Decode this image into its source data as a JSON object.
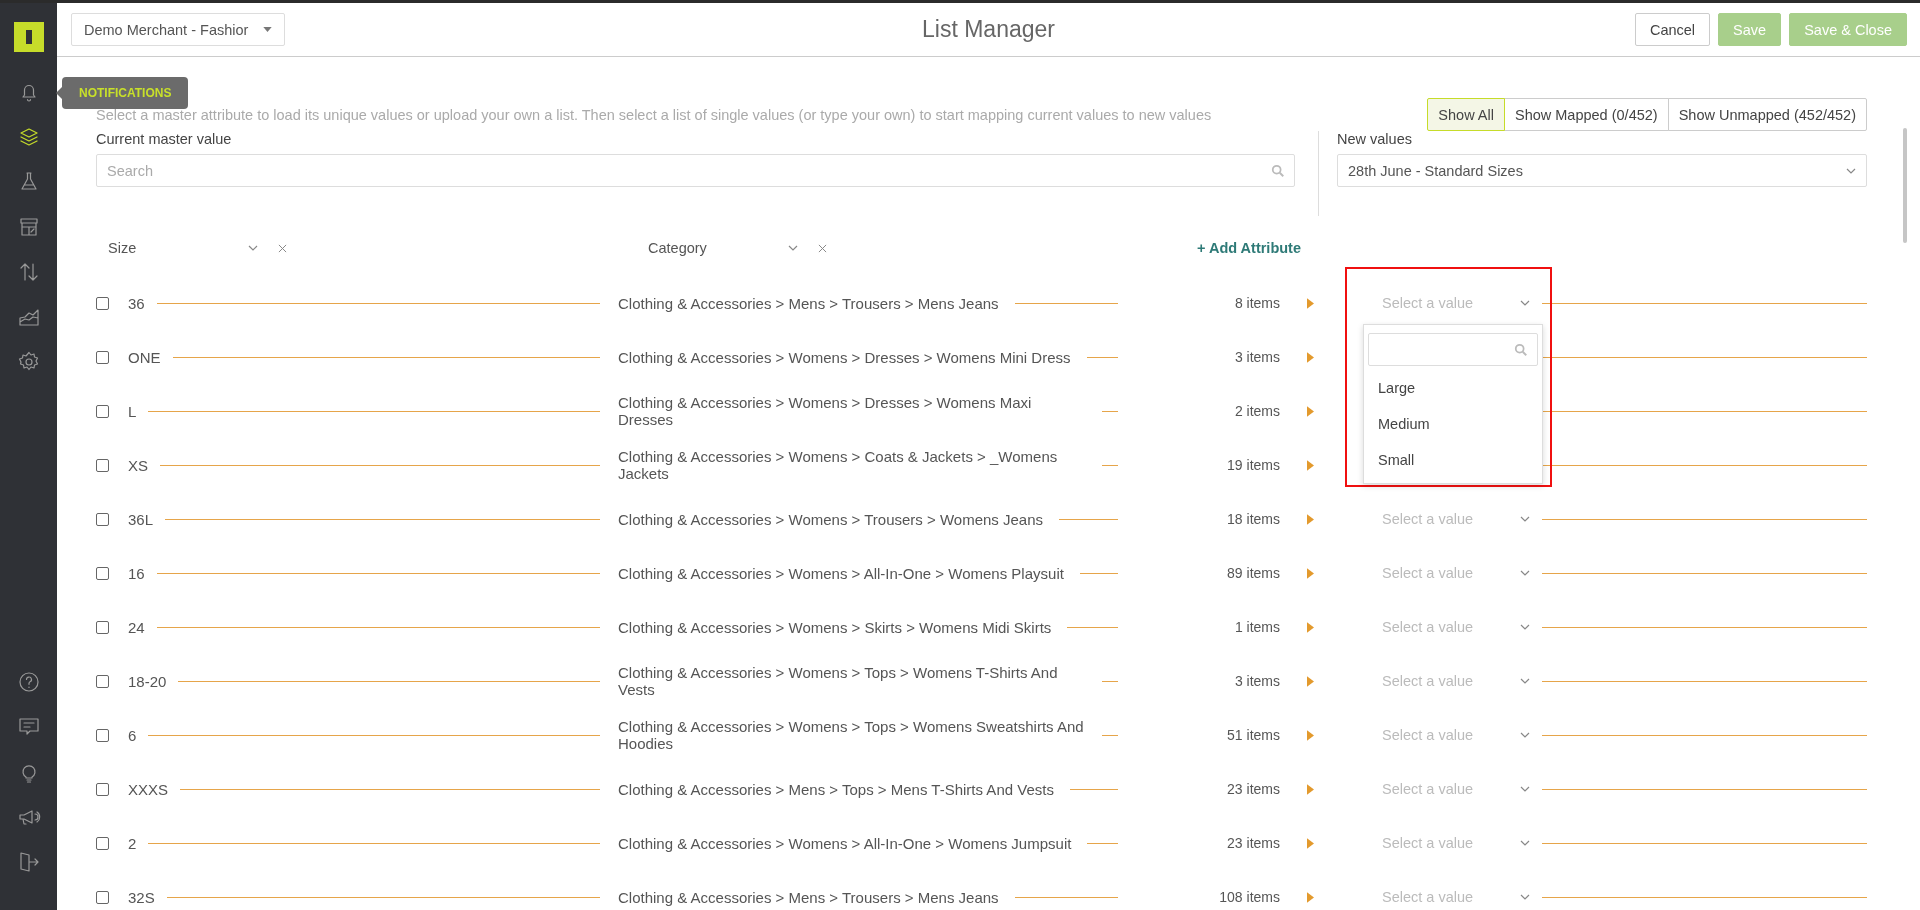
{
  "sidebar": {
    "items": [
      {
        "selected": false
      },
      {
        "selected": true
      },
      {
        "selected": false
      },
      {
        "selected": false
      },
      {
        "selected": false
      },
      {
        "selected": false
      },
      {
        "selected": false
      }
    ],
    "bottom_items": [
      {
        "selected": false
      },
      {
        "selected": false
      },
      {
        "selected": false
      },
      {
        "selected": false
      },
      {
        "selected": false
      }
    ]
  },
  "tooltip": {
    "text": "NOTIFICATIONS"
  },
  "merchant_select": {
    "value": "Demo Merchant - Fashior"
  },
  "title": "List Manager",
  "buttons": [
    {
      "label": "Cancel",
      "kind": "secondary"
    },
    {
      "label": "Save",
      "kind": "primary"
    },
    {
      "label": "Save & Close",
      "kind": "primary"
    }
  ],
  "description": "Select a master attribute to load its unique values or upload your own a list. Then select a list of single values (or type your own) to start mapping current values to new values",
  "filters": [
    {
      "label": "Show All",
      "selected": true
    },
    {
      "label": "Show Mapped (0/452)",
      "selected": false
    },
    {
      "label": "Show Unmapped (452/452)",
      "selected": false
    }
  ],
  "current_master": {
    "label": "Current master value",
    "placeholder": "Search"
  },
  "new_values": {
    "label": "New values",
    "value": "28th June - Standard Sizes"
  },
  "attributes": [
    {
      "label": "Size"
    },
    {
      "label": "Category"
    }
  ],
  "add_attribute": "+ Add Attribute",
  "rows": [
    {
      "checked": false,
      "size": "36",
      "category": "Clothing & Accessories > Mens > Trousers > Mens Jeans",
      "items": "8 items",
      "select": {
        "placeholder": "Select a value",
        "expanded": true
      }
    },
    {
      "checked": false,
      "size": "ONE",
      "category": "Clothing & Accessories > Womens > Dresses > Womens Mini Dress",
      "items": "3 items"
    },
    {
      "checked": false,
      "size": "L",
      "category": "Clothing & Accessories > Womens > Dresses > Womens Maxi Dresses",
      "items": "2 items"
    },
    {
      "checked": false,
      "size": "XS",
      "category": "Clothing & Accessories > Womens > Coats & Jackets > _Womens Jackets",
      "items": "19 items"
    },
    {
      "checked": false,
      "size": "36L",
      "category": "Clothing & Accessories > Womens > Trousers > Womens Jeans",
      "items": "18 items",
      "select": {
        "placeholder": "Select a value"
      }
    },
    {
      "checked": false,
      "size": "16",
      "category": "Clothing & Accessories > Womens > All-In-One > Womens Playsuit",
      "items": "89 items",
      "select": {
        "placeholder": "Select a value"
      }
    },
    {
      "checked": false,
      "size": "24",
      "category": "Clothing & Accessories > Womens > Skirts > Womens Midi Skirts",
      "items": "1 items",
      "select": {
        "placeholder": "Select a value"
      }
    },
    {
      "checked": false,
      "size": "18-20",
      "category": "Clothing & Accessories > Womens > Tops > Womens T-Shirts And Vests",
      "items": "3 items",
      "select": {
        "placeholder": "Select a value"
      }
    },
    {
      "checked": false,
      "size": "6",
      "category": "Clothing & Accessories > Womens > Tops > Womens Sweatshirts And Hoodies",
      "items": "51 items",
      "select": {
        "placeholder": "Select a value"
      }
    },
    {
      "checked": false,
      "size": "XXXS",
      "category": "Clothing & Accessories > Mens > Tops > Mens T-Shirts And Vests",
      "items": "23 items",
      "select": {
        "placeholder": "Select a value"
      }
    },
    {
      "checked": false,
      "size": "2",
      "category": "Clothing & Accessories > Womens > All-In-One > Womens Jumpsuit",
      "items": "23 items",
      "select": {
        "placeholder": "Select a value"
      }
    },
    {
      "checked": false,
      "size": "32S",
      "category": "Clothing & Accessories > Mens > Trousers > Mens Jeans",
      "items": "108 items",
      "select": {
        "placeholder": "Select a value"
      }
    }
  ],
  "dropdown": {
    "options": [
      "Large",
      "Medium",
      "Small"
    ]
  }
}
